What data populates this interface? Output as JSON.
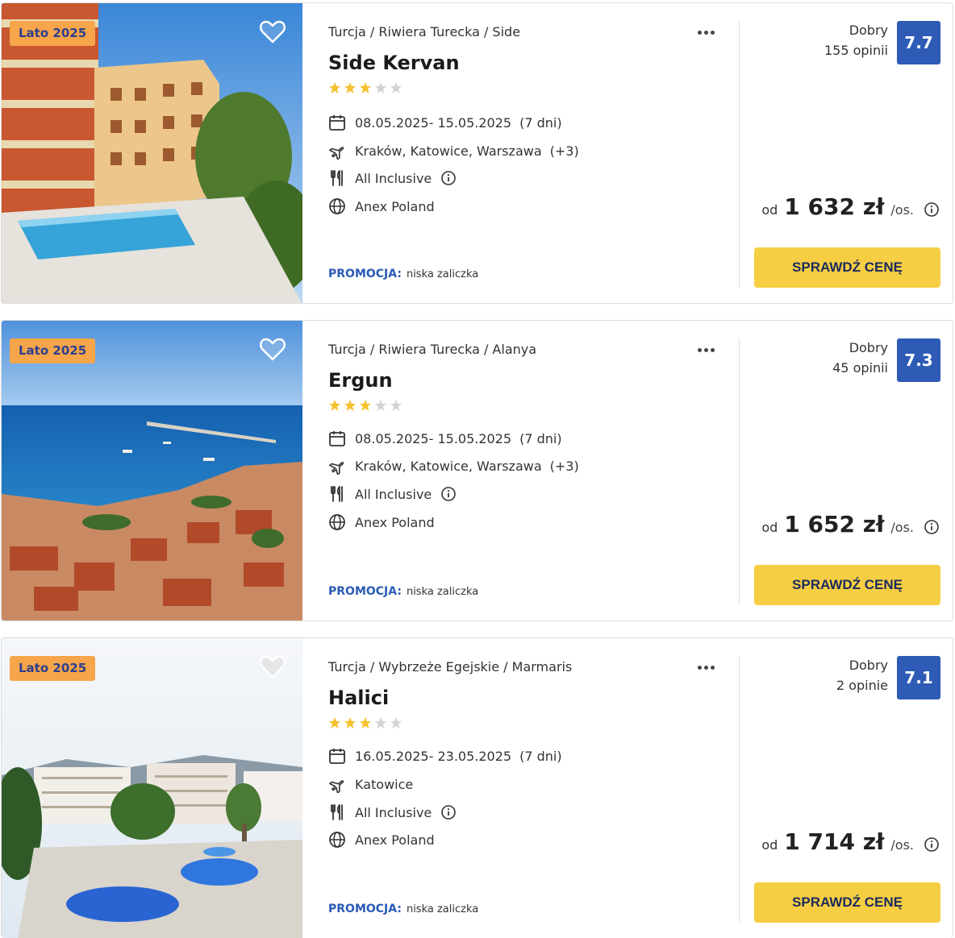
{
  "colors": {
    "badge_bg": "#f6a54a",
    "badge_text": "#2c3f8e",
    "rating_box": "#2d5bb5",
    "cta_bg": "#f6ce43",
    "promo_label": "#2b5bb6",
    "star_filled": "#f5c12e",
    "star_empty": "#d3d3d3"
  },
  "offers": [
    {
      "season_badge": "Lato 2025",
      "breadcrumb": "Turcja / Riwiera Turecka / Side",
      "name": "Side Kervan",
      "stars": 3,
      "stars_max": 5,
      "dates": "08.05.2025- 15.05.2025",
      "duration": "(7 dni)",
      "departures": "Kraków, Katowice, Warszawa",
      "departures_extra": "(+3)",
      "board": "All Inclusive",
      "operator": "Anex Poland",
      "promo_label": "PROMOCJA:",
      "promo_text": "niska zaliczka",
      "rating_word": "Dobry",
      "rating_count": "155 opinii",
      "rating": "7.7",
      "price_prefix": "od",
      "price": "1 632 zł",
      "price_suffix": "/os.",
      "cta": "SPRAWDŹ CENĘ",
      "photo_icon": "hotel-pool-photo"
    },
    {
      "season_badge": "Lato 2025",
      "breadcrumb": "Turcja / Riwiera Turecka / Alanya",
      "name": "Ergun",
      "stars": 3,
      "stars_max": 5,
      "dates": "08.05.2025- 15.05.2025",
      "duration": "(7 dni)",
      "departures": "Kraków, Katowice, Warszawa",
      "departures_extra": "(+3)",
      "board": "All Inclusive",
      "operator": "Anex Poland",
      "promo_label": "PROMOCJA:",
      "promo_text": "niska zaliczka",
      "rating_word": "Dobry",
      "rating_count": "45 opinii",
      "rating": "7.3",
      "price_prefix": "od",
      "price": "1 652 zł",
      "price_suffix": "/os.",
      "cta": "SPRAWDŹ CENĘ",
      "photo_icon": "harbor-town-photo"
    },
    {
      "season_badge": "Lato 2025",
      "breadcrumb": "Turcja / Wybrzeże Egejskie / Marmaris",
      "name": "Halici",
      "stars": 3,
      "stars_max": 5,
      "dates": "16.05.2025- 23.05.2025",
      "duration": "(7 dni)",
      "departures": "Katowice",
      "departures_extra": "",
      "board": "All Inclusive",
      "operator": "Anex Poland",
      "promo_label": "PROMOCJA:",
      "promo_text": "niska zaliczka",
      "rating_word": "Dobry",
      "rating_count": "2 opinie",
      "rating": "7.1",
      "price_prefix": "od",
      "price": "1 714 zł",
      "price_suffix": "/os.",
      "cta": "SPRAWDŹ CENĘ",
      "photo_icon": "resort-pools-photo"
    }
  ]
}
